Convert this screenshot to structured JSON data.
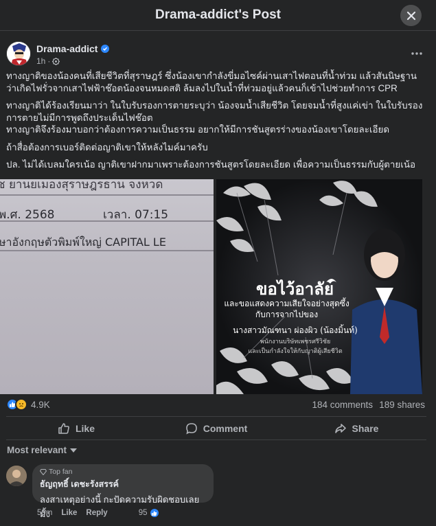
{
  "header": {
    "title": "Drama-addict's Post"
  },
  "post": {
    "author": "Drama-addict",
    "time": "1h",
    "paragraphs": [
      "ทางญาติของน้องคนที่เสียชีวิตที่สุราษฎร์ ซึ่งน้องเขากำลังขี่มอไซค์ผ่านเสาไฟตอนที่น้ำท่วม แล้วสันนิษฐานว่าเกิดไฟรั่วจากเสาไฟฟ้าช๊อตน้องจนหมดสติ ล้มลงไปในน้ำที่ท่วมอยู่แล้วคนก็เข้าไปช่วยทำการ CPR",
      "ทางญาติได้ร้องเรียนมาว่า ในใบรับรองการตายระบุว่า น้องจมน้ำเสียชีวิต โดยจมน้ำที่สูงแค่เข่า ในใบรับรองการตายไม่มีการพูดถึงประเด็นไฟช๊อต\nทางญาติจึงร้องมาบอกว่าต้องการความเป็นธรรม อยากให้มีการชันสูตรร่างของน้องเขาโดยละเอียด",
      "ถ้าสื่อต้องการเบอร์ติดต่อญาติเขาให้หลังไมค์มาครับ",
      "ปล. ไม่ได้เบลมใครเน้อ ญาติเขาฝากมาเพราะต้องการชันสูตรโดยละเอียด เพื่อความเป็นธรรมกับผู้ตายเน้อ"
    ]
  },
  "media": {
    "doc_lines": [
      "ช ยานยเมองสุราษฎรธาน จงหวด",
      "พ.ศ. 2568",
      "เวลา. 07:15",
      "ษาอังกฤษตัวพิมพ์ใหญ่ CAPITAL LE"
    ],
    "memorial": {
      "title": "ขอไว้อาลัย",
      "line1": "และขอแสดงความเสียใจอย่างสุดซึ้ง",
      "line2": "กับการจากไปของ",
      "name": "นางสาวมัณฑนา ผ่องผิว (น้องมิ้นท์)",
      "job": "พนักงานบริษัทเพชรศรีวิชัย",
      "condolence": "และเป็นกำลังใจให้กับญาติผู้เสียชีวิต"
    }
  },
  "stats": {
    "reactions": "4.9K",
    "comments": "184 comments",
    "shares": "189 shares"
  },
  "actions": {
    "like": "Like",
    "comment": "Comment",
    "share": "Share"
  },
  "sort": {
    "label": "Most relevant"
  },
  "comment": {
    "badge": "Top fan",
    "author": "ธัญฤทธิ์ เดชะรังสรรค์",
    "text": "ลงสาเหตุอย่างนี้ กะปัดความรับผิดชอบเลยมั้ง",
    "time": "59m",
    "like": "Like",
    "reply": "Reply",
    "likes": "95"
  },
  "colors": {
    "accent": "#2d88ff",
    "background": "#242526"
  }
}
